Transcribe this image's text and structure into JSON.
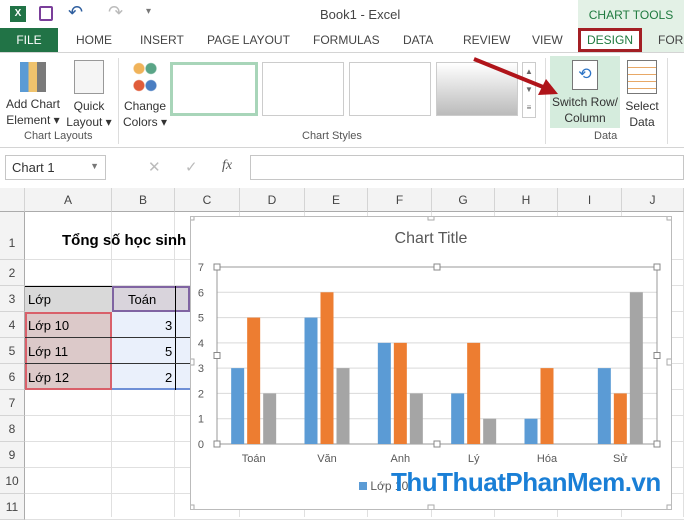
{
  "window": {
    "title": "Book1 - Excel",
    "context_tab_group": "CHART TOOLS"
  },
  "tabs": [
    "FILE",
    "HOME",
    "INSERT",
    "PAGE LAYOUT",
    "FORMULAS",
    "DATA",
    "REVIEW",
    "VIEW",
    "DESIGN",
    "FORMAT"
  ],
  "tab_display": [
    "FILE",
    "HOME",
    "INSERT",
    "PAGE LAYOUT",
    "FORMULAS",
    "DATA",
    "REVIEW",
    "VIEW",
    "DESIGN",
    "FORI"
  ],
  "ribbon": {
    "add_chart_element": [
      "Add Chart",
      "Element ▾"
    ],
    "quick_layout": [
      "Quick",
      "Layout ▾"
    ],
    "change_colors": [
      "Change",
      "Colors ▾"
    ],
    "switch_row_column": [
      "Switch Row/",
      "Column"
    ],
    "select_data": [
      "Select",
      "Data"
    ],
    "groups": {
      "chart_layouts": "Chart Layouts",
      "chart_styles": "Chart Styles",
      "data": "Data"
    }
  },
  "formula_bar": {
    "name_box": "Chart 1",
    "fx": "fx",
    "value": ""
  },
  "columns": [
    "A",
    "B",
    "C",
    "D",
    "E",
    "F",
    "G",
    "H",
    "I",
    "J"
  ],
  "rows": [
    "1",
    "2",
    "3",
    "4",
    "5",
    "6",
    "7",
    "8",
    "9",
    "10",
    "11"
  ],
  "sheet": {
    "title": "Tổng số học sinh",
    "header": {
      "a": "Lớp",
      "b": "Toán"
    },
    "data": [
      {
        "a": "Lớp 10",
        "b": "3"
      },
      {
        "a": "Lớp 11",
        "b": "5"
      },
      {
        "a": "Lớp 12",
        "b": "2"
      }
    ]
  },
  "watermark": "ThuThuatPhanMem.vn",
  "colors": {
    "accent": "#217346",
    "blue": "#5b9bd5",
    "orange": "#ed7d31",
    "gray": "#a5a5a5",
    "highlight": "#a31f24"
  },
  "chart_data": {
    "type": "bar",
    "title": "Chart Title",
    "categories": [
      "Toán",
      "Văn",
      "Anh",
      "Lý",
      "Hóa",
      "Sử"
    ],
    "series": [
      {
        "name": "Lớp 10",
        "color": "#5b9bd5",
        "values": [
          3,
          5,
          4,
          2,
          1,
          3
        ]
      },
      {
        "name": "Lớp 11",
        "color": "#ed7d31",
        "values": [
          5,
          6,
          4,
          4,
          3,
          2
        ]
      },
      {
        "name": "Lớp 12",
        "color": "#a5a5a5",
        "values": [
          2,
          3,
          2,
          1,
          0,
          6
        ]
      }
    ],
    "ylim": [
      0,
      7
    ],
    "yticks": [
      "0",
      "1",
      "2",
      "3",
      "4",
      "5",
      "6",
      "7"
    ],
    "grid": true,
    "legend": "bottom",
    "legend_visible": [
      "Lớp 10"
    ]
  }
}
